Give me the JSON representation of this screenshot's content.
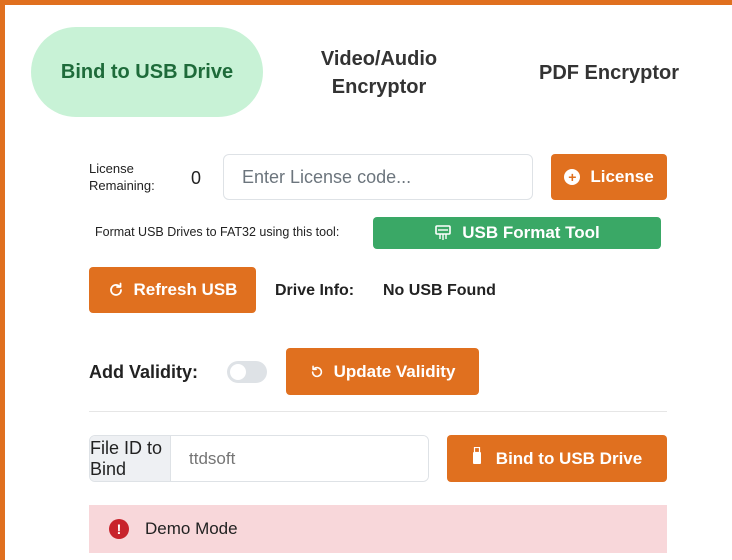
{
  "tabs": {
    "bind": "Bind to USB Drive",
    "video_line1": "Video/Audio",
    "video_line2": "Encryptor",
    "pdf": "PDF Encryptor"
  },
  "license": {
    "label_line1": "License",
    "label_line2": "Remaining:",
    "count": "0",
    "placeholder": "Enter License code...",
    "button": "License"
  },
  "format": {
    "label": "Format USB Drives to FAT32 using this tool:",
    "button": "USB Format Tool"
  },
  "usb": {
    "refresh_button": "Refresh USB",
    "drive_label": "Drive Info:",
    "drive_value": "No USB Found"
  },
  "validity": {
    "label": "Add Validity:",
    "toggle_on": false,
    "button": "Update Validity"
  },
  "bind": {
    "file_id_label": "File ID to Bind",
    "file_id_placeholder": "ttdsoft",
    "button": "Bind to USB Drive"
  },
  "alert": {
    "text": "Demo Mode"
  },
  "colors": {
    "accent": "#e0701f",
    "success": "#3aa866",
    "tab_active_bg": "#c8f2d6",
    "danger_bg": "#f8d7da",
    "danger": "#c8232c"
  }
}
